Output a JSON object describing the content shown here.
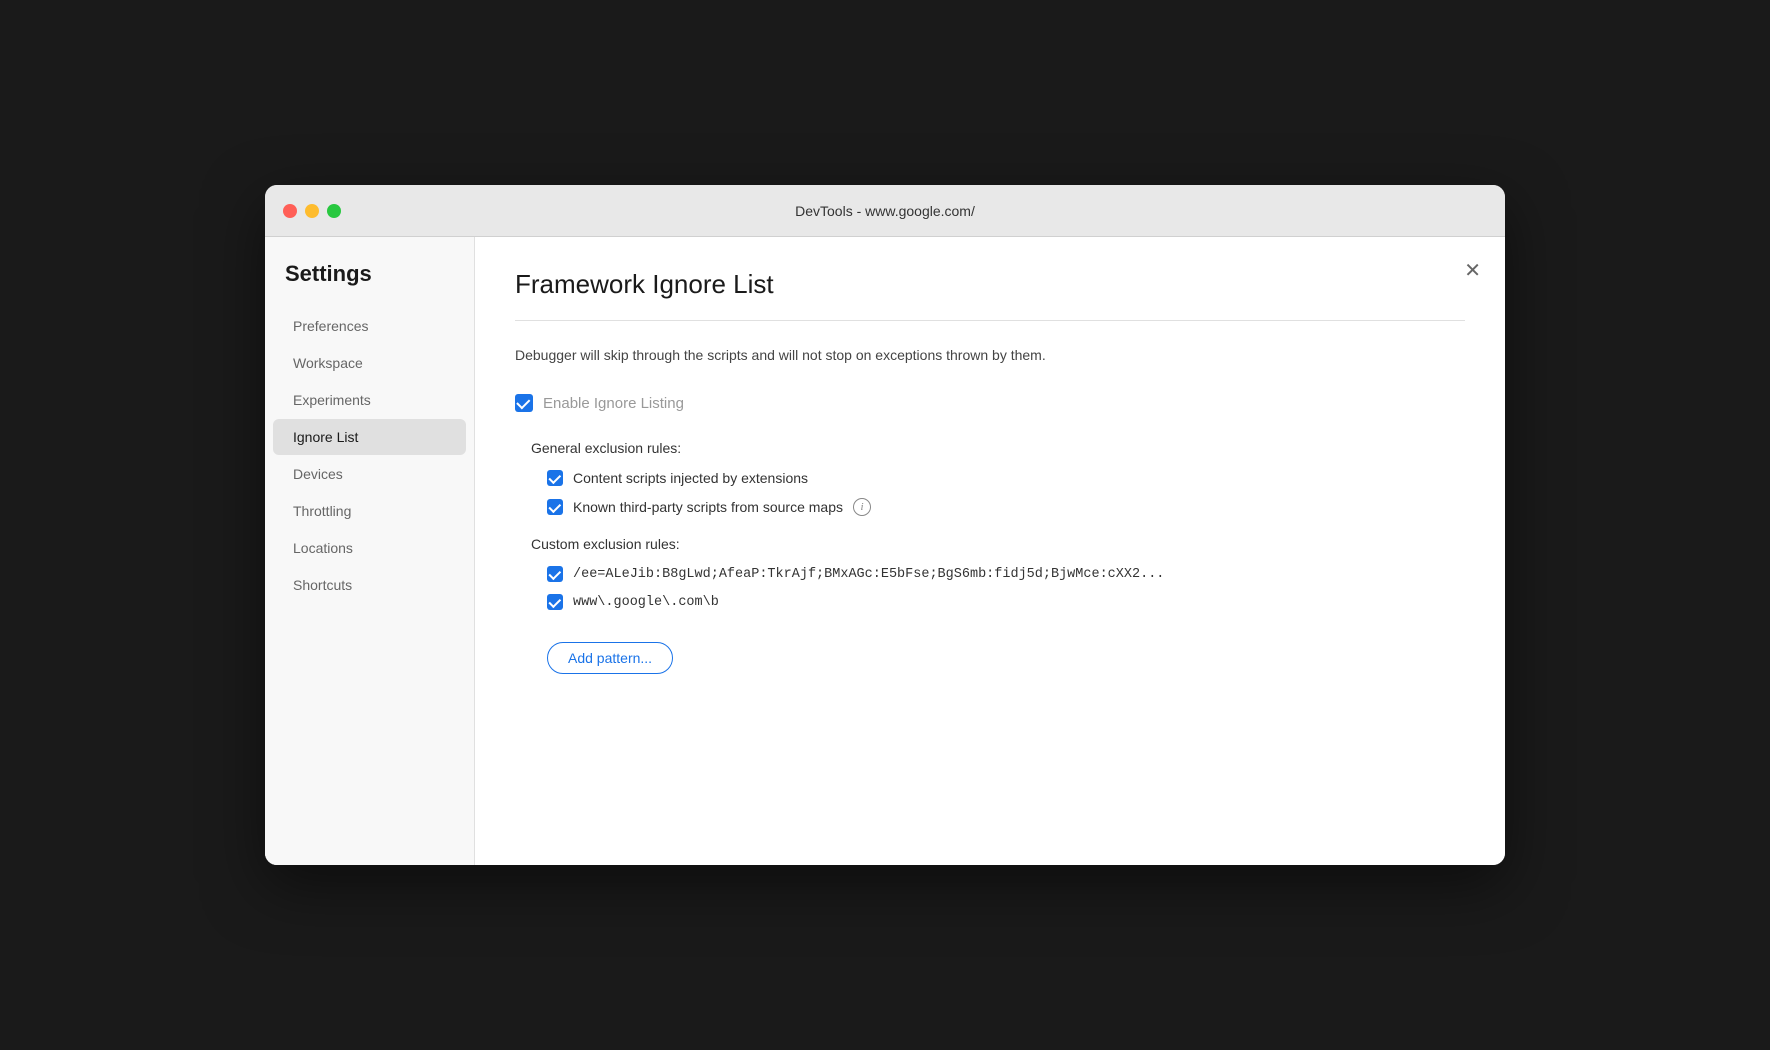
{
  "window": {
    "title": "DevTools - www.google.com/"
  },
  "sidebar": {
    "heading": "Settings",
    "items": [
      {
        "id": "preferences",
        "label": "Preferences",
        "active": false
      },
      {
        "id": "workspace",
        "label": "Workspace",
        "active": false
      },
      {
        "id": "experiments",
        "label": "Experiments",
        "active": false
      },
      {
        "id": "ignore-list",
        "label": "Ignore List",
        "active": true
      },
      {
        "id": "devices",
        "label": "Devices",
        "active": false
      },
      {
        "id": "throttling",
        "label": "Throttling",
        "active": false
      },
      {
        "id": "locations",
        "label": "Locations",
        "active": false
      },
      {
        "id": "shortcuts",
        "label": "Shortcuts",
        "active": false
      }
    ]
  },
  "main": {
    "title": "Framework Ignore List",
    "description": "Debugger will skip through the scripts and will not stop on exceptions thrown by them.",
    "enable_ignore_listing_label": "Enable Ignore Listing",
    "general_exclusion_label": "General exclusion rules:",
    "content_scripts_label": "Content scripts injected by extensions",
    "known_third_party_label": "Known third-party scripts from source maps",
    "custom_exclusion_label": "Custom exclusion rules:",
    "custom_rule_1": "/ee=ALeJib:B8gLwd;AfeaP:TkrAjf;BMxAGc:E5bFse;BgS6mb:fidj5d;BjwMce:cXX2...",
    "custom_rule_2": "www\\.google\\.com\\b",
    "add_pattern_label": "Add pattern..."
  },
  "colors": {
    "accent": "#1a73e8",
    "close": "#ff5f57",
    "minimize": "#febc2e",
    "maximize": "#28c840"
  }
}
